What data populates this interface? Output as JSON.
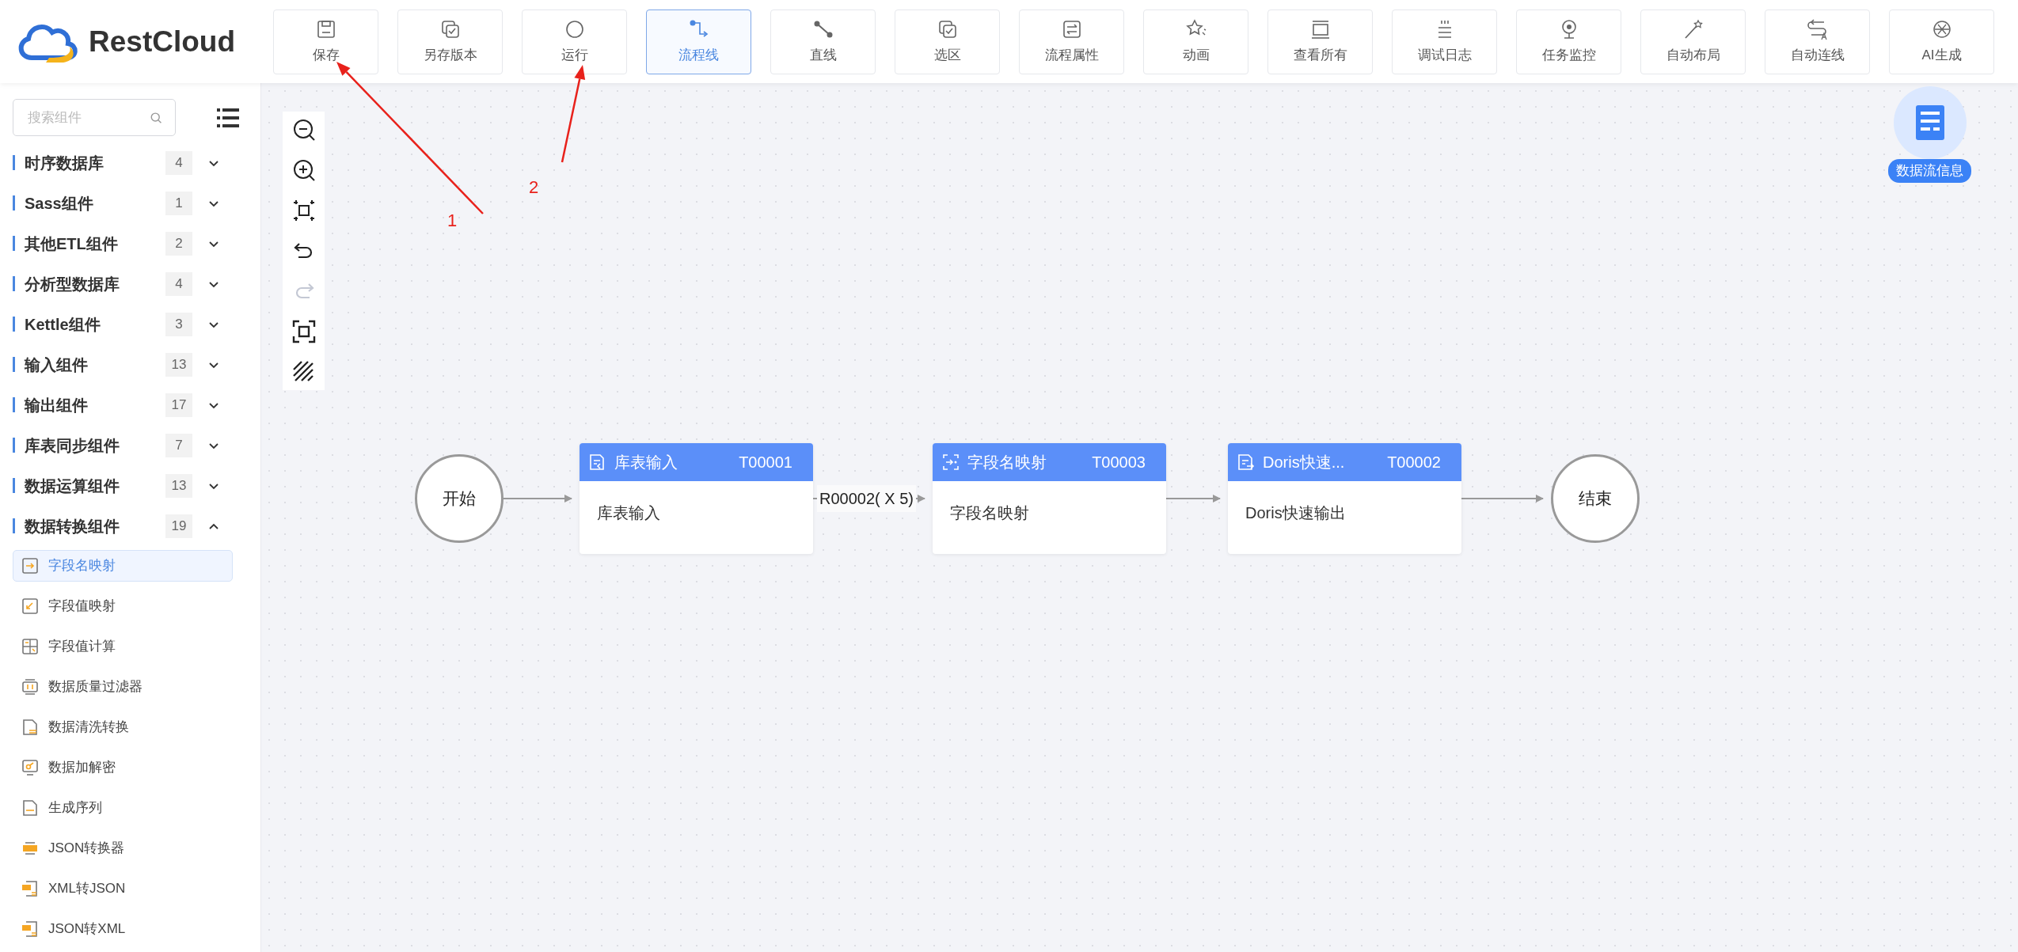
{
  "app": {
    "logo_text": "RestCloud"
  },
  "toolbar": [
    {
      "label": "保存",
      "selected": false
    },
    {
      "label": "另存版本",
      "selected": false
    },
    {
      "label": "运行",
      "selected": false
    },
    {
      "label": "流程线",
      "selected": true
    },
    {
      "label": "直线",
      "selected": false
    },
    {
      "label": "选区",
      "selected": false
    },
    {
      "label": "流程属性",
      "selected": false
    },
    {
      "label": "动画",
      "selected": false
    },
    {
      "label": "查看所有",
      "selected": false
    },
    {
      "label": "调试日志",
      "selected": false
    },
    {
      "label": "任务监控",
      "selected": false
    },
    {
      "label": "自动布局",
      "selected": false
    },
    {
      "label": "自动连线",
      "selected": false
    },
    {
      "label": "AI生成",
      "selected": false
    }
  ],
  "sidebar": {
    "search": {
      "placeholder": "搜索组件"
    },
    "categories": [
      {
        "label": "时序数据库",
        "count": "4",
        "expanded": false
      },
      {
        "label": "Sass组件",
        "count": "1",
        "expanded": false
      },
      {
        "label": "其他ETL组件",
        "count": "2",
        "expanded": false
      },
      {
        "label": "分析型数据库",
        "count": "4",
        "expanded": false
      },
      {
        "label": "Kettle组件",
        "count": "3",
        "expanded": false
      },
      {
        "label": "输入组件",
        "count": "13",
        "expanded": false
      },
      {
        "label": "输出组件",
        "count": "17",
        "expanded": false
      },
      {
        "label": "库表同步组件",
        "count": "7",
        "expanded": false
      },
      {
        "label": "数据运算组件",
        "count": "13",
        "expanded": false
      },
      {
        "label": "数据转换组件",
        "count": "19",
        "expanded": true,
        "children": [
          {
            "label": "字段名映射",
            "selected": true
          },
          {
            "label": "字段值映射",
            "selected": false
          },
          {
            "label": "字段值计算",
            "selected": false
          },
          {
            "label": "数据质量过滤器",
            "selected": false
          },
          {
            "label": "数据清洗转换",
            "selected": false
          },
          {
            "label": "数据加解密",
            "selected": false
          },
          {
            "label": "生成序列",
            "selected": false
          },
          {
            "label": "JSON转换器",
            "selected": false
          },
          {
            "label": "XML转JSON",
            "selected": false
          },
          {
            "label": "JSON转XML",
            "selected": false
          }
        ]
      }
    ]
  },
  "canvas_tools": [
    {
      "disabled": false
    },
    {
      "disabled": false
    },
    {
      "disabled": false
    },
    {
      "disabled": false
    },
    {
      "disabled": true
    },
    {
      "disabled": false
    },
    {
      "disabled": false
    }
  ],
  "flow": {
    "start": "开始",
    "end": "结束",
    "nodes": [
      {
        "title": "库表输入",
        "code": "T00001",
        "body": "库表输入"
      },
      {
        "title": "字段名映射",
        "code": "T00003",
        "body": "字段名映射",
        "incoming_label": "R00002( X 5)"
      },
      {
        "title": "Doris快速...",
        "code": "T00002",
        "body": "Doris快速输出"
      }
    ]
  },
  "info_badge": {
    "label": "数据流信息"
  },
  "annotations": [
    {
      "label": "1"
    },
    {
      "label": "2"
    }
  ]
}
